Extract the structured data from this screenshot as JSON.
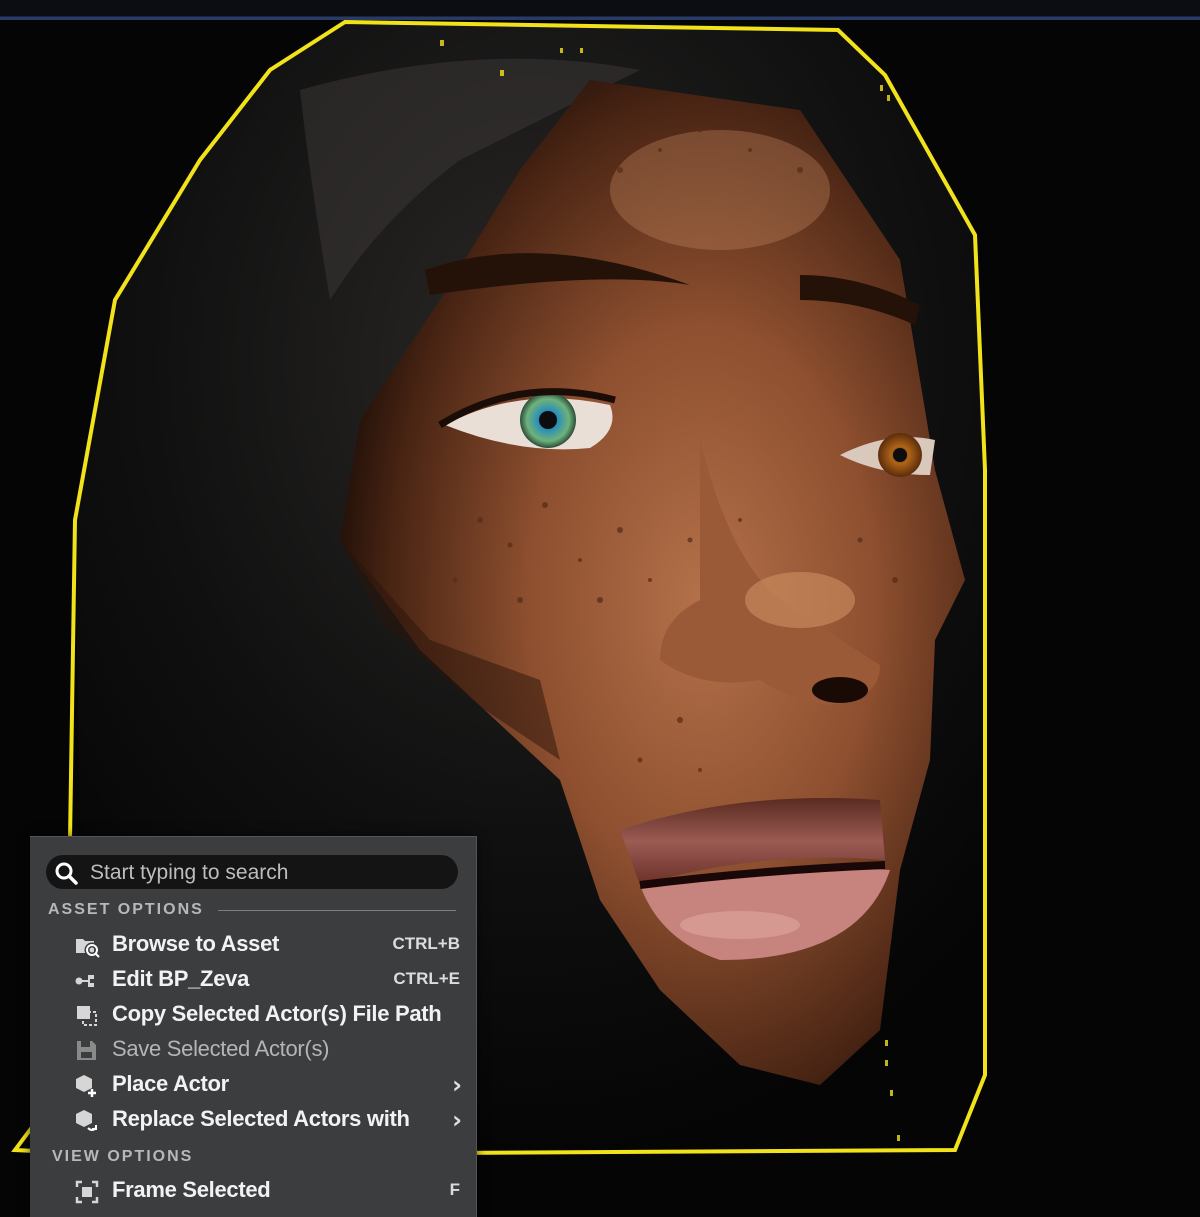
{
  "viewport": {
    "selection_outline_color": "#f2e21a",
    "subject": "character-head-render"
  },
  "context_menu": {
    "search": {
      "placeholder": "Start typing to search",
      "icon": "search-icon"
    },
    "sections": [
      {
        "title": "ASSET OPTIONS",
        "items": [
          {
            "label": "Browse to Asset",
            "shortcut": "CTRL+B",
            "icon": "browse-folder-icon",
            "enabled": true
          },
          {
            "label": "Edit BP_Zeva",
            "shortcut": "CTRL+E",
            "icon": "blueprint-edit-icon",
            "enabled": true
          },
          {
            "label": "Copy Selected Actor(s) File Path",
            "shortcut": "",
            "icon": "copy-path-icon",
            "enabled": true
          },
          {
            "label": "Save Selected Actor(s)",
            "shortcut": "",
            "icon": "save-icon",
            "enabled": false
          },
          {
            "label": "Place Actor",
            "submenu": true,
            "icon": "place-actor-icon",
            "enabled": true
          },
          {
            "label": "Replace Selected Actors with",
            "submenu": true,
            "icon": "replace-actor-icon",
            "enabled": true
          }
        ]
      },
      {
        "title": "VIEW OPTIONS",
        "items": [
          {
            "label": "Frame Selected",
            "shortcut": "F",
            "icon": "frame-selected-icon",
            "enabled": true
          }
        ]
      }
    ],
    "submenu_glyph": "›"
  }
}
